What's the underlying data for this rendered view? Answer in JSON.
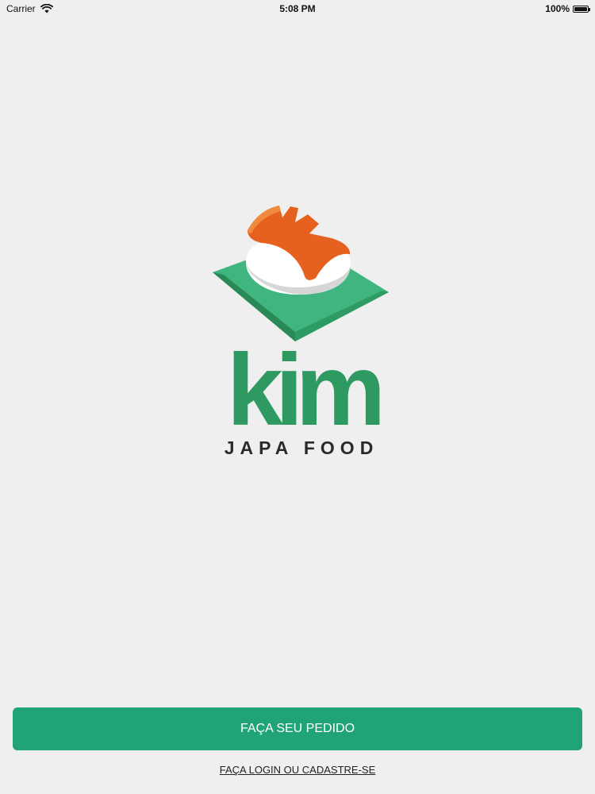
{
  "status_bar": {
    "carrier": "Carrier",
    "time": "5:08 PM",
    "battery": "100%"
  },
  "logo": {
    "name": "kim",
    "tagline": "JAPA FOOD",
    "colors": {
      "green": "#2e9a62",
      "orange": "#e5611d",
      "dark": "#2a2a2a"
    }
  },
  "actions": {
    "primary_label": "FAÇA SEU PEDIDO",
    "secondary_label": "FAÇA LOGIN OU CADASTRE-SE"
  },
  "theme": {
    "background": "#efefef",
    "accent": "#20a477"
  }
}
